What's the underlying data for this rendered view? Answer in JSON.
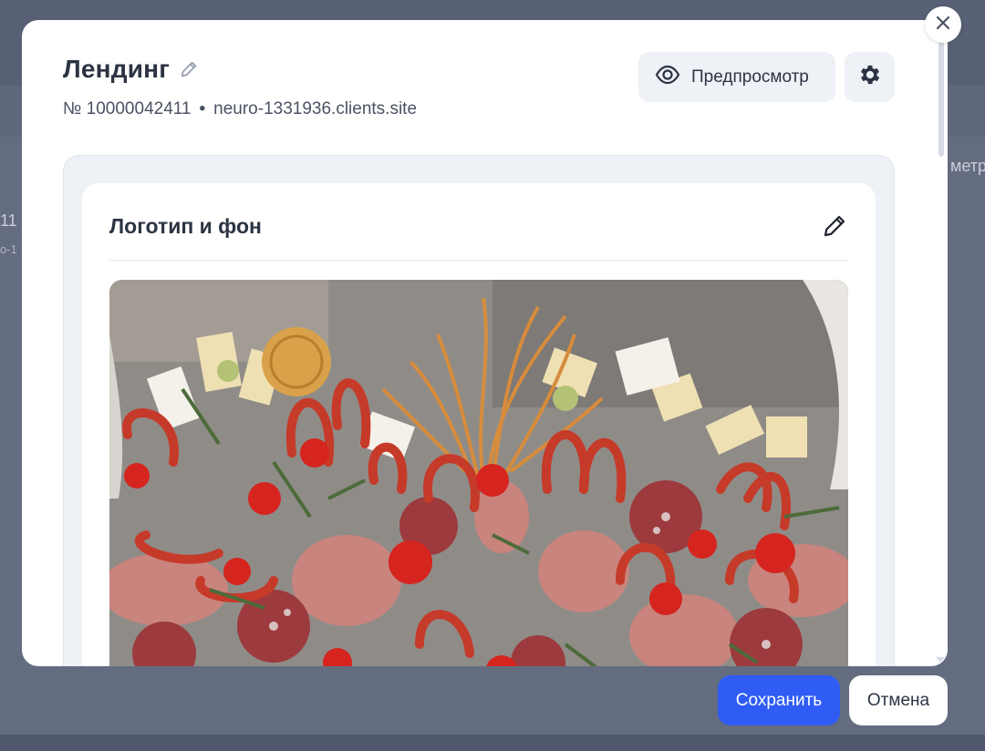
{
  "background": {
    "left_text_1": "11",
    "left_text_2": "o-1",
    "right_text": "метр"
  },
  "modal": {
    "title": "Лендинг",
    "number": "№ 10000042411",
    "separator": "•",
    "domain": "neuro-1331936.clients.site",
    "preview_label": "Предпросмотр",
    "section": {
      "title": "Логотип и фон"
    }
  },
  "footer": {
    "save_label": "Сохранить",
    "cancel_label": "Отмена"
  },
  "colors": {
    "accent": "#2f5cf5",
    "overlay": "#5f677b",
    "surface": "#ffffff",
    "button_bg": "#eef1f6"
  },
  "icons": {
    "title_edit": "pencil-icon",
    "preview": "eye-icon",
    "settings": "gear-icon",
    "section_edit": "pencil-icon",
    "close": "close-icon"
  }
}
